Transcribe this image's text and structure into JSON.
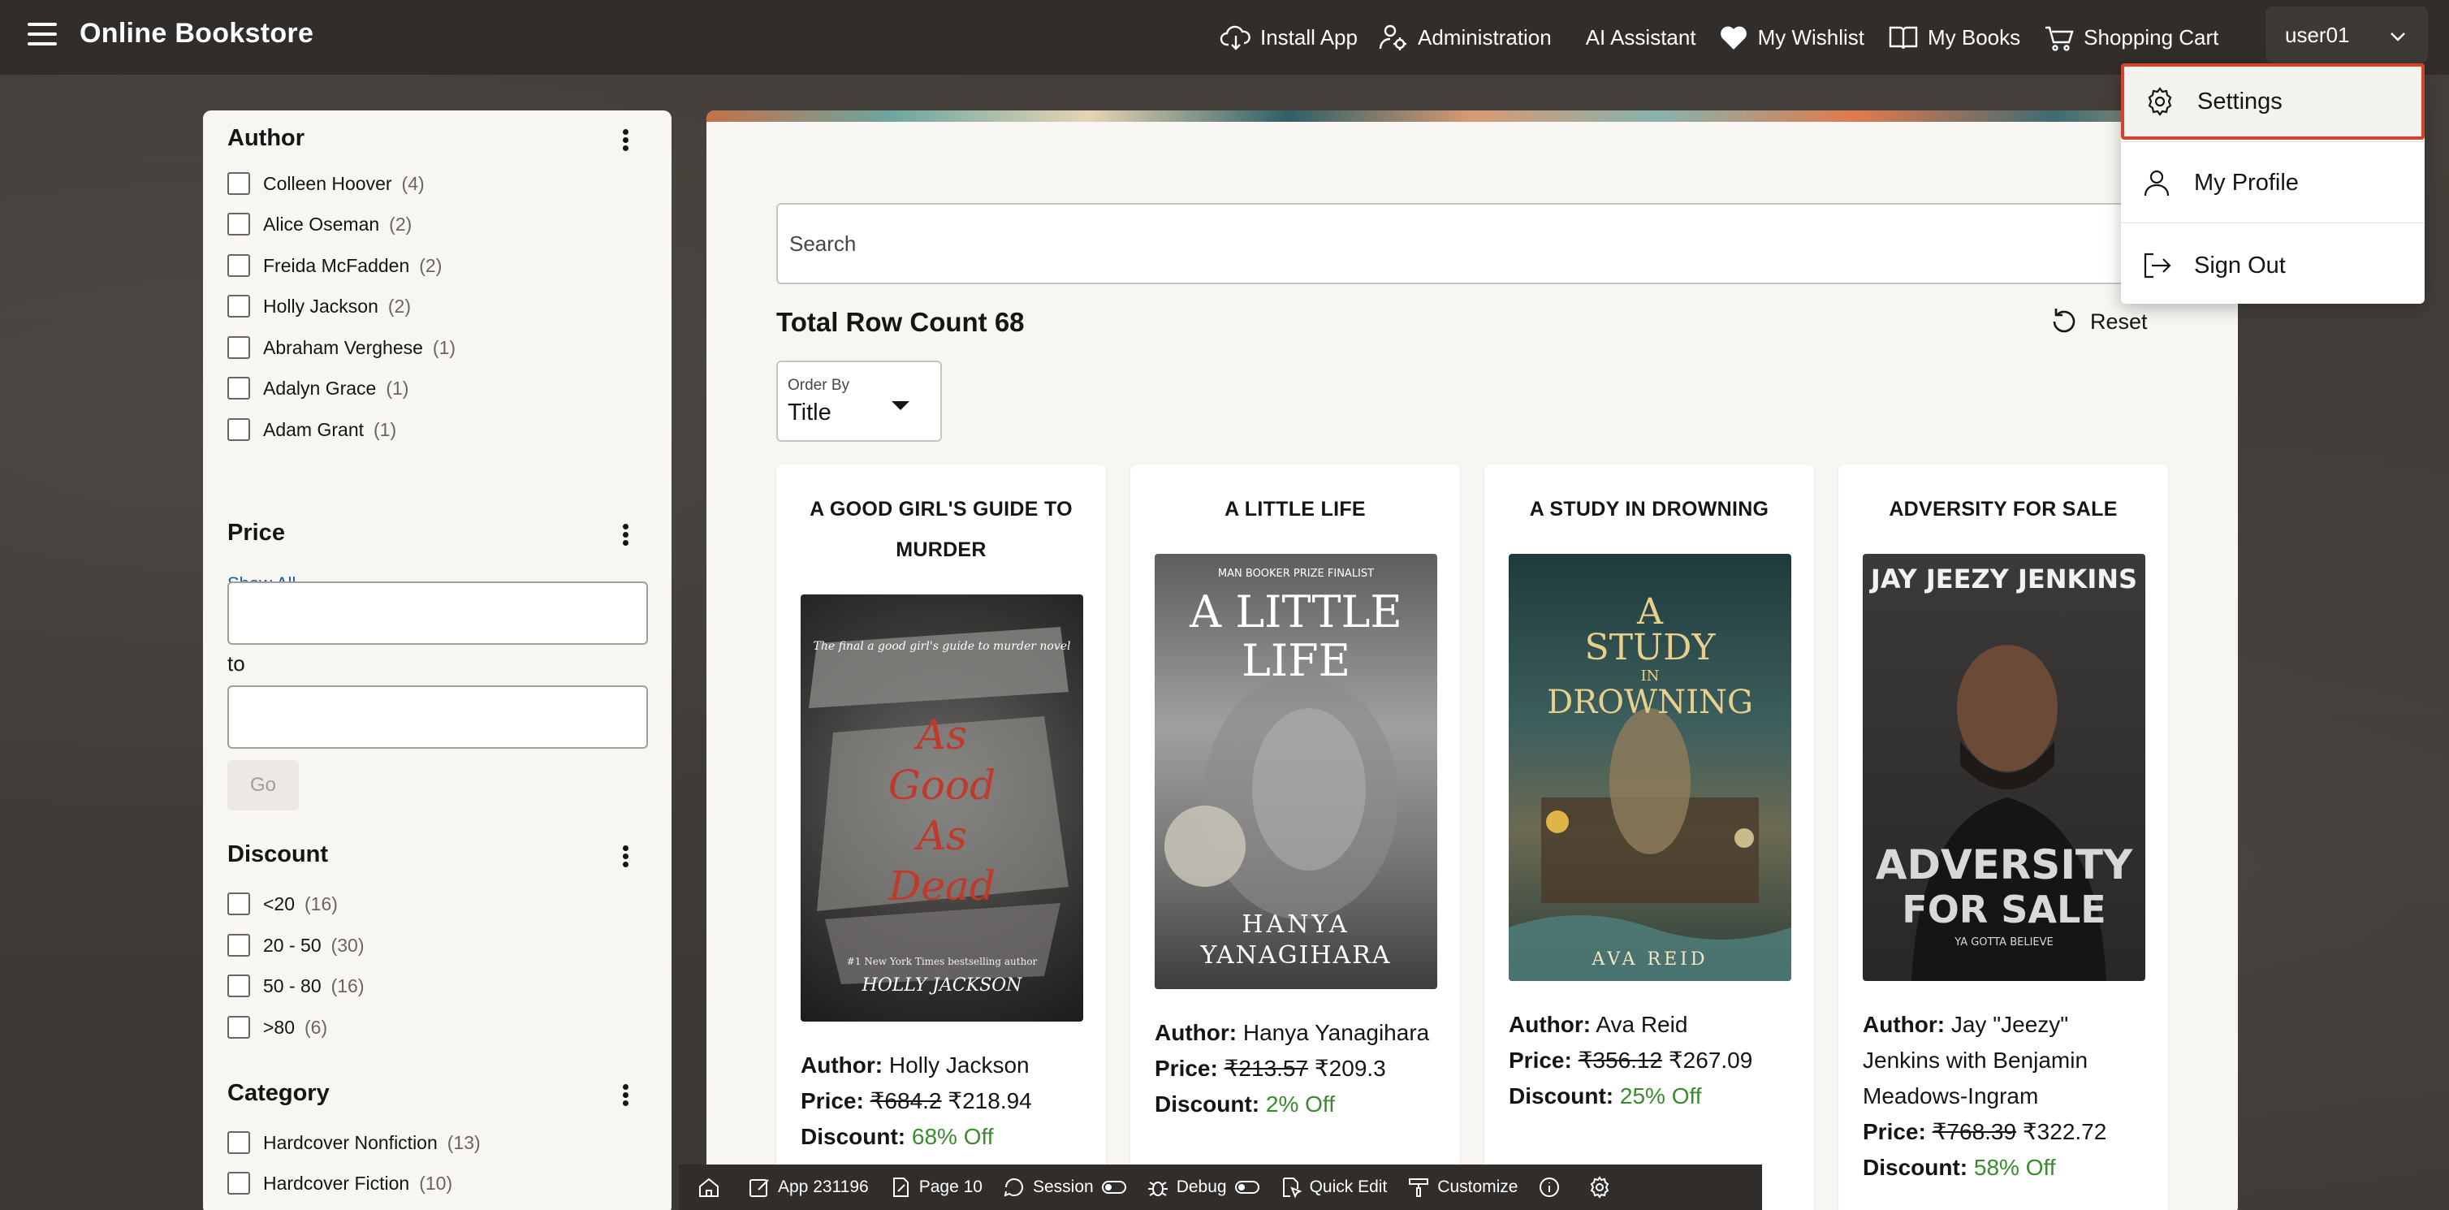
{
  "app": {
    "title": "Online Bookstore"
  },
  "nav": {
    "install_app": "Install App",
    "administration": "Administration",
    "ai_assistant": "AI Assistant",
    "my_wishlist": "My Wishlist",
    "my_books": "My Books",
    "shopping_cart": "Shopping Cart",
    "user": "user01"
  },
  "user_dropdown": {
    "items": [
      {
        "label": "Settings",
        "icon": "gear-icon",
        "highlighted": true
      },
      {
        "label": "My Profile",
        "icon": "user-icon"
      },
      {
        "label": "Sign Out",
        "icon": "sign-out-icon"
      }
    ]
  },
  "facets": {
    "author": {
      "title": "Author",
      "items": [
        {
          "label": "Colleen Hoover",
          "count": "(4)"
        },
        {
          "label": "Alice Oseman",
          "count": "(2)"
        },
        {
          "label": "Freida McFadden",
          "count": "(2)"
        },
        {
          "label": "Holly Jackson",
          "count": "(2)"
        },
        {
          "label": "Abraham Verghese",
          "count": "(1)"
        },
        {
          "label": "Adalyn Grace",
          "count": "(1)"
        },
        {
          "label": "Adam Grant",
          "count": "(1)"
        }
      ],
      "show_all": "Show All"
    },
    "price": {
      "title": "Price",
      "to_label": "to",
      "go_label": "Go"
    },
    "discount": {
      "title": "Discount",
      "items": [
        {
          "label": "<20",
          "count": "(16)"
        },
        {
          "label": "20 - 50",
          "count": "(30)"
        },
        {
          "label": "50 - 80",
          "count": "(16)"
        },
        {
          "label": ">80",
          "count": "(6)"
        }
      ]
    },
    "category": {
      "title": "Category",
      "items": [
        {
          "label": "Hardcover Nonfiction",
          "count": "(13)"
        },
        {
          "label": "Hardcover Fiction",
          "count": "(10)"
        }
      ]
    }
  },
  "main": {
    "search_placeholder": "Search",
    "total_row_count": "Total Row Count 68",
    "reset_label": "Reset",
    "order_by": {
      "label": "Order By",
      "value": "Title"
    }
  },
  "books": [
    {
      "title": "A GOOD GIRL'S GUIDE TO MURDER",
      "cover_text": [
        "As",
        "Good",
        "As",
        "Dead"
      ],
      "cover_top": "The final a good girl's guide to murder novel",
      "cover_bottom": "#1 New York Times bestselling author",
      "cover_author": "HOLLY JACKSON",
      "author_label": "Author:",
      "author": "Holly Jackson",
      "price_label": "Price:",
      "old_price": "₹684.2",
      "new_price": "₹218.94",
      "discount_label": "Discount:",
      "discount": "68% Off"
    },
    {
      "title": "A LITTLE LIFE",
      "cover_top": "MAN BOOKER PRIZE FINALIST",
      "cover_title": [
        "A LITTLE",
        "LIFE"
      ],
      "cover_author": [
        "HANYA",
        "YANAGIHARA"
      ],
      "author_label": "Author:",
      "author": "Hanya Yanagihara",
      "price_label": "Price:",
      "old_price": "₹213.57",
      "new_price": "₹209.3",
      "discount_label": "Discount:",
      "discount": "2% Off"
    },
    {
      "title": "A STUDY IN DROWNING",
      "cover_title": [
        "A",
        "STUDY",
        "IN",
        "DROWNING"
      ],
      "cover_author": "AVA REID",
      "author_label": "Author:",
      "author": "Ava Reid",
      "price_label": "Price:",
      "old_price": "₹356.12",
      "new_price": "₹267.09",
      "discount_label": "Discount:",
      "discount": "25% Off"
    },
    {
      "title": "ADVERSITY FOR SALE",
      "cover_top": "JAY JEEZY JENKINS",
      "cover_title": [
        "ADVERSITY",
        "FOR SALE"
      ],
      "cover_sub": "YA GOTTA BELIEVE",
      "author_label": "Author:",
      "author": "Jay \"Jeezy\" Jenkins with Benjamin Meadows-Ingram",
      "price_label": "Price:",
      "old_price": "₹768.39",
      "new_price": "₹322.72",
      "discount_label": "Discount:",
      "discount": "58% Off"
    }
  ],
  "devbar": {
    "app": "App 231196",
    "page": "Page 10",
    "session": "Session",
    "debug": "Debug",
    "quick_edit": "Quick Edit",
    "customize": "Customize"
  },
  "colors": {
    "topbar": "#312d2a",
    "highlight_border": "#d6432c",
    "discount_green": "#3b8a2f",
    "link": "#1a5fa8"
  }
}
